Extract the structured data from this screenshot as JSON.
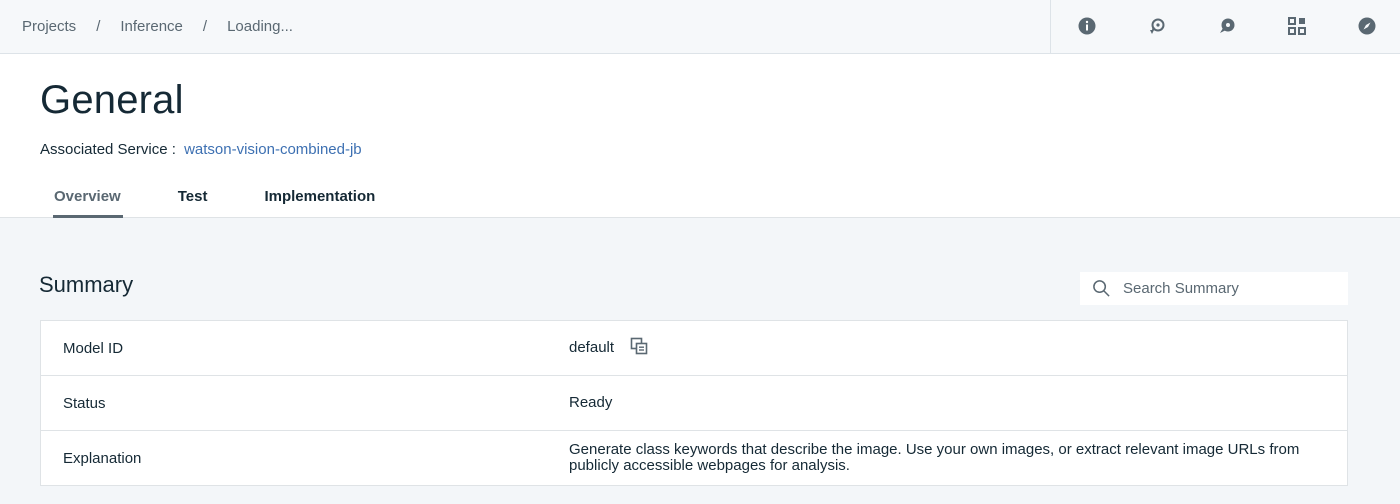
{
  "breadcrumb": [
    "Projects",
    "Inference",
    "Loading..."
  ],
  "breadcrumb_separator": "/",
  "toolbar_icons": [
    "info-icon",
    "refresh-icon",
    "chat-icon",
    "apps-grid-icon",
    "compass-icon"
  ],
  "header": {
    "title": "General",
    "service_label": "Associated Service :",
    "service_name": "watson-vision-combined-jb"
  },
  "tabs": [
    {
      "label": "Overview",
      "active": true
    },
    {
      "label": "Test",
      "active": false
    },
    {
      "label": "Implementation",
      "active": false
    }
  ],
  "summary": {
    "title": "Summary",
    "search_placeholder": "Search Summary",
    "rows": [
      {
        "key": "Model ID",
        "value": "default"
      },
      {
        "key": "Status",
        "value": "Ready"
      },
      {
        "key": "Explanation",
        "value": "Generate class keywords that describe the image. Use your own images, or extract relevant image URLs from publicly accessible webpages for analysis."
      }
    ]
  },
  "colors": {
    "text": "#152935",
    "muted": "#5a6872",
    "link": "#3d70b2",
    "icon": "#5a6872"
  }
}
